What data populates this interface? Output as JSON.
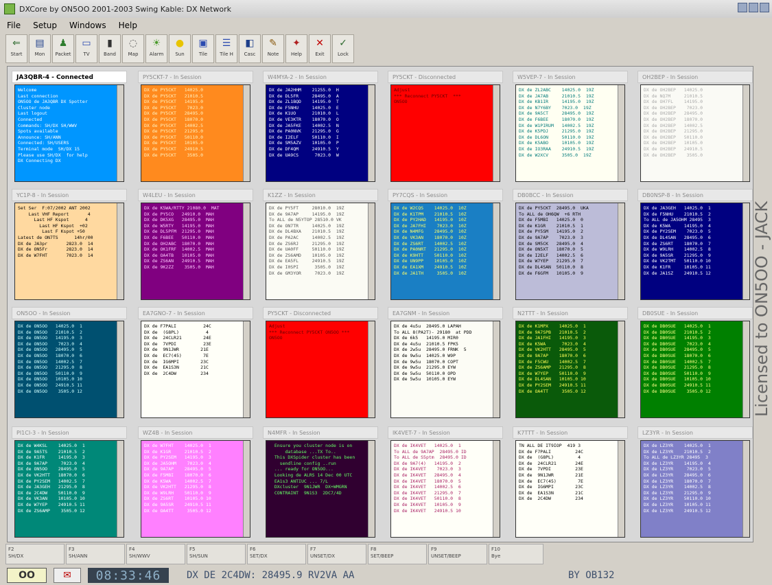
{
  "window": {
    "title": "DXCore by ON5OO 2001-2003 Swing Kable: DX Network"
  },
  "menu": [
    "File",
    "Setup",
    "Windows",
    "Help"
  ],
  "toolbar": [
    {
      "label": "Start",
      "icon": "start-icon",
      "glyph": "⇐",
      "color": "#2e6a2e"
    },
    {
      "label": "Mon",
      "icon": "monitor-icon",
      "glyph": "▤",
      "color": "#1e3f8a"
    },
    {
      "label": "Packet",
      "icon": "packet-icon",
      "glyph": "♟",
      "color": "#2f7d2f"
    },
    {
      "label": "TV",
      "icon": "tv-icon",
      "glyph": "▭",
      "color": "#2b4bb0"
    },
    {
      "label": "Band",
      "icon": "band-icon",
      "glyph": "▮",
      "color": "#333"
    },
    {
      "label": "Map",
      "icon": "map-icon",
      "glyph": "◌",
      "color": "#555"
    },
    {
      "label": "Alarm",
      "icon": "alarm-icon",
      "glyph": "☀",
      "color": "#4a9a2a"
    },
    {
      "label": "Sun",
      "icon": "sun-icon",
      "glyph": "●",
      "color": "#e8c400"
    },
    {
      "label": "Tile",
      "icon": "tile-icon",
      "glyph": "▣",
      "color": "#2b4bb0"
    },
    {
      "label": "Tile H",
      "icon": "tile-horizontal-icon",
      "glyph": "☰",
      "color": "#2b4bb0"
    },
    {
      "label": "Casc",
      "icon": "cascade-icon",
      "glyph": "◧",
      "color": "#1e3f8a"
    },
    {
      "label": "Note",
      "icon": "note-icon",
      "glyph": "✎",
      "color": "#8a5a10"
    },
    {
      "label": "Help",
      "icon": "help-icon",
      "glyph": "✦",
      "color": "#b02020"
    },
    {
      "label": "Exit",
      "icon": "exit-icon",
      "glyph": "✕",
      "color": "#c00000"
    },
    {
      "label": "Lock",
      "icon": "lock-icon",
      "glyph": "✓",
      "color": "#2e6a2e"
    }
  ],
  "panels": [
    {
      "title": "JA3QBR-4 - Connected",
      "active": true,
      "bg": "#0096ff",
      "fg": "#ffffff",
      "lines": [
        "Welcome",
        "Last connection",
        "ON5OO de JA3QBR DX Spotter",
        "Cluster node",
        "Last logout",
        "Connected",
        "Commands: SH/DX SH/WWV",
        "Spots available",
        "Announce: SH/ANN",
        "Connected: SH/USERS",
        "",
        "Terminal mode  SH/DX 15",
        "Please use SH/DX  for help",
        "DX Connecting DX"
      ]
    },
    {
      "title": "PY5CKT-7 - In Session",
      "bg": "#ff8a1e",
      "fg": "#fff2c0",
      "lines": [
        "DX de PY5CKT   14025.0",
        "DX de PY5CKT   21010.5",
        "DX de PY5CKT   14195.0",
        "DX de PY5CKT    7023.0",
        "DX de PY5CKT   28495.0",
        "DX de PY5CKT   18070.0",
        "DX de PY5CKT   14002.5",
        "DX de PY5CKT   21295.0",
        "DX de PY5CKT   50110.0",
        "DX de PY5CKT   10105.0",
        "DX de PY5CKT   24910.5",
        "DX de PY5CKT    3505.0"
      ]
    },
    {
      "title": "W4MYA-2 - In Session",
      "bg": "#000080",
      "fg": "#ffffff",
      "lines": [
        "DX de JA2HHM    21255.0  H",
        "DX de DL5FR     28495.0  A",
        "DX de ZL1BQD    14195.0  T",
        "DX de F5NHU     14025.0  E",
        "DX de K1UO      21010.0  L",
        "DX de VE3KTR    18070.0  O",
        "DX de JA5FKE    14002.5  N",
        "DX de PA0NVK    21295.0  G",
        "DX de I2ELF     50110.0  I",
        "DX de SM5AZV    10105.0  P",
        "DX de DF4QM     24910.5  Y",
        "DX de UA9CS      7023.0  W"
      ]
    },
    {
      "title": "PY5CKT - Disconnected",
      "bg": "#ff0000",
      "fg": "#660000",
      "lines": [
        "Adjust",
        "*** Reconnect PY5CKT  ***",
        "ON5OO"
      ]
    },
    {
      "title": "W5VEP-7 - In Session",
      "bg": "#fffff2",
      "fg": "#007a7a",
      "lines": [
        "DX de ZL2ABC    14025.0  19Z",
        "DX de JA7AB     21010.5  19Z",
        "DX de KB1IR     14195.0  19Z",
        "DX de N7Y6BY    7023.0  19Z",
        "DX de 9A5CT     28495.0  19Z",
        "DX de F6BEE     18070.0  19Z",
        "DX de W1PIRUM   14002.5  19Z",
        "DX de K5PDJ     21295.0  19Z",
        "DX de DL6ON     50110.0  19Z",
        "DX de K5ABO     10105.0  19Z",
        "DX de IO3RAA    24910.5  19Z",
        "DX de W2XCV     3505.0  19Z"
      ]
    },
    {
      "title": "OH2BEP - In Session",
      "bg": "#fafaf5",
      "fg": "#aaaaaa",
      "lines": [
        "DX de OH2BEP   14025.0",
        "DX de NQ7M     21010.5",
        "DX de OH7FL    14195.0",
        "DX de OH2BEP    7023.0",
        "DX de OH2BEP   28495.0",
        "DX de OH2BEP   18070.0",
        "DX de OH2BEP   14002.5",
        "DX de OH2BEP   21295.0",
        "DX de OH2BEP   50110.0",
        "DX de OH2BEP   10105.0",
        "DX de OH2BEP   24910.5",
        "DX de OH2BEP    3505.0"
      ]
    },
    {
      "title": "YC1P-8 - In Session",
      "bg": "#ffd9a0",
      "fg": "#000000",
      "lines": [
        "Set Ser  F:07/2002 ANT 2002",
        "    Last VHF Report       4",
        "      Last HF Kspot      4",
        "        Last HF Kspot  +02",
        "         Last F Kspot +50",
        "",
        "Latest de ON7TS      14hr/00",
        "DX de JA3pr       2823.0  14",
        "DX de ON5Fr       2823.0  14",
        "DX de W7FHT       7023.0  14"
      ]
    },
    {
      "title": "W4LEU - In Session",
      "bg": "#800080",
      "fg": "#ffccff",
      "lines": [
        "DX de K5WA/RTTY 21080.0  MAT",
        "DX de PY5CO   24910.0  MAH",
        "DX de DK5XG   28495.0  MAH",
        "DX de W5RTY   14195.0  MAH",
        "DX de DL5PFM  21295.0  MAH",
        "DX de F6BEE   50110.0  MAH",
        "DX de OH2ABC  18070.0  MAH",
        "DX de OK1FRF  14002.5  MAH",
        "DX de OA4TB   10105.0  MAH",
        "DX de ZS6AN   24910.5  MAH",
        "DX de 9K2ZZ    3505.0  MAH"
      ]
    },
    {
      "title": "K1ZZ - In Session",
      "bg": "#fbfbf4",
      "fg": "#555555",
      "lines": [
        "DX de PY5FT     28010.0  19Z",
        "DX de 9A7AP     14195.0  19Z",
        "To ALL de N5YTOP 28510.0 VK",
        "DX de ON7TR     14025.0  19Z",
        "DX de DL4BXA    21010.5  19Z",
        "DX de PA2AC     14002.5  19Z",
        "DX de ZS6RJ     21295.0  19Z",
        "DX de UA0FF     50110.0  19Z",
        "DX de ZS6AMD    10105.0  19Z",
        "DX de EA5FL     24910.5  19Z",
        "DX de I0SPI      3505.0  19Z",
        "DX de GM3YOR     7023.0  19Z"
      ]
    },
    {
      "title": "PY7CQS - In Session",
      "bg": "#1a7fc4",
      "fg": "#ffff66",
      "lines": [
        "DX de W2CQS    14025.0  10Z",
        "DX de K1TPM    21010.5  10Z",
        "DX de PY2HAD   14195.0  10Z",
        "DX de JA7FHI    7023.0  10Z",
        "DX de N4MFG    28495.0  10Z",
        "DX de VK3AN    18070.0  10Z",
        "DX de ZS6RT    14002.5  10Z",
        "DX de PA0NRT   21295.0  10Z",
        "DX de K9HTT    50110.0  10Z",
        "DX de UN9PP    10105.0  10Z",
        "DX de EA1XM    24910.5  10Z",
        "DX de JA1TH     3505.0  10Z"
      ]
    },
    {
      "title": "DB0BCC - In Session",
      "bg": "#bcbcd8",
      "fg": "#000000",
      "lines": [
        "DX de PY5CKT  28495.0  UKA",
        "To ALL de OH6QW  +6 RTH",
        "DX de F5MBI   14025.0  0",
        "DX de K1GR    21010.5  1",
        "DX de PY5SM   14195.0  2",
        "DX de 9A7AP    7023.0  3",
        "DX de SM5CK   28495.0  4",
        "DX de ON5XT   18070.0  5",
        "DX de I2ELF   14002.5  6",
        "DX de W7YEP   21295.0  7",
        "DX de DL4SAN  50110.0  8",
        "DX de F6GFM   10105.0  9"
      ]
    },
    {
      "title": "DB0NSP-8 - In Session",
      "bg": "#000080",
      "fg": "#ffffff",
      "lines": [
        "DX de JA3GEH   14025.0  1",
        "DX de F5NHU    21010.5  2",
        "To ALL de JA5OHM 28495  3",
        "DX de K5WA     14195.0  4",
        "DX de PY2SEM    7023.0  5",
        "DX de DL4SAN   28495.0  6",
        "DX de ZS6RT    18070.0  7",
        "DX de W9LRH    14002.5  8",
        "DX de 9A5SR    21295.0  9",
        "DX de VK2TMT   50110.0 10",
        "DX de K1FR     10105.0 11",
        "DX de JA1SZ    24910.5 12"
      ]
    },
    {
      "title": "ON5OO - In Session",
      "bg": "#005070",
      "fg": "#d0ffff",
      "lines": [
        "DX de ON5OO   14025.0  1",
        "DX de ON5OO   21010.5  2",
        "DX de ON5OO   14195.0  3",
        "DX de ON5OO    7023.0  4",
        "DX de ON5OO   28495.0  5",
        "DX de ON5OO   18070.0  6",
        "DX de ON5OO   14002.5  7",
        "DX de ON5OO   21295.0  8",
        "DX de ON5OO   50110.0  9",
        "DX de ON5OO   10105.0 10",
        "DX de ON5OO   24910.5 11",
        "DX de ON5OO    3505.0 12"
      ]
    },
    {
      "title": "EA7GNO-7 - In Session",
      "bg": "#fffff8",
      "fg": "#000000",
      "lines": [
        "DX de F7PALI          24C",
        "DX de  (G8PL)          4",
        "DX de  24CLR21        24E",
        "DX de  7VPDI          23E",
        "DX de  9N1JWR        21E",
        "DX de  EC7(45)        7E",
        "DX de  IG6MPI        23C",
        "DX de  EA1S3N        21C",
        "DX de  2C4DW         234"
      ]
    },
    {
      "title": "PY5CKT - Disconnected",
      "bg": "#ff0000",
      "fg": "#660000",
      "lines": [
        "Adjust",
        "*** Reconnect PY5CKT ON5OO ***",
        "ON5OO"
      ]
    },
    {
      "title": "EA7GNM - In Session",
      "bg": "#fcfcf5",
      "fg": "#000000",
      "lines": [
        "DX de 4u5u  28495.0 LAPAH",
        "To ALL 8(PA2T)- 29180  at PDD",
        "DX de 6k5   14195.0 MIR0",
        "DX de 4u5u  21010.5 FPK5",
        "DX de 2w5u  28495.0 FRNK  5",
        "DX de 9w5u  14025.0 W9P",
        "DX de 9w5u  18070.0 COPT",
        "DX de 9w5u  21295.0 EYW",
        "DX de 5w5u  50110.0 OPD",
        "DX de 5w5u  10105.0 EYW"
      ]
    },
    {
      "title": "N2TTT - In Session",
      "bg": "#0a5a0a",
      "fg": "#ffff55",
      "lines": [
        "DX de K1MPX    14025.0  1",
        "DX de 9A7SPB   21010.5  2",
        "DX de JA1FHI   14195.0  3",
        "DX de K5WA      7023.0  4",
        "DX de VK2HTT   28495.0  5",
        "DX de 9A7AP    18070.0  6",
        "DX de F5CWU    14002.5  7",
        "DX de ZS6AMP   21295.0  8",
        "DX de W7YEP    50110.0  9",
        "DX de DL4SAN   10105.0 10",
        "DX de PY2SEM   24910.5 11",
        "DX de OA4TT     3505.0 12"
      ]
    },
    {
      "title": "DB0SUE - In Session",
      "bg": "#008000",
      "fg": "#ffff88",
      "lines": [
        "DX de DB0SUE   14025.0  1",
        "DX de DB0SUE   21010.5  2",
        "DX de DB0SUE   14195.0  3",
        "DX de DB0SUE    7023.0  4",
        "DX de DB0SUE   28495.0  5",
        "DX de DB0SUE   18070.0  6",
        "DX de DB0SUE   14002.5  7",
        "DX de DB0SUE   21295.0  8",
        "DX de DB0SUE   50110.0  9",
        "DX de DB0SUE   10105.0 10",
        "DX de DB0SUE   24910.5 11",
        "DX de DB0SUE    3505.0 12"
      ]
    },
    {
      "title": "PI1CI-3 - In Session",
      "bg": "#008878",
      "fg": "#ffffff",
      "lines": [
        "DX de W4KSL    14025.0  1",
        "DX de 9A5TS    21010.5  2",
        "DX de K1FR     14195.0  3",
        "DX de 9A7AP     7023.0  4",
        "DX de ON5OO    28495.0  5",
        "DX de VK2HTT   18070.0  6",
        "DX de PY2SEM   14002.5  7",
        "DX de JA3GEH   21295.0  8",
        "DX de 2C4DW    50110.0  9",
        "DX de VK3AN    10105.0 10",
        "DX de W7YEP    24910.5 11",
        "DX de ZS6AMP    3505.0 12"
      ]
    },
    {
      "title": "WZ4B - In Session",
      "bg": "#ff80ff",
      "fg": "#ffffff",
      "lines": [
        "DX de W7FHT    14025.0  1",
        "DX de K1GR     21010.5  2",
        "DX de PY2SEM   14195.0  3",
        "DX de JA5OHM    7023.0  4",
        "DX de 9A7AP    28495.0  5",
        "DX de F5MBI    18070.0  6",
        "DX de K5WA     14002.5  7",
        "DX de VK2HTT   21295.0  8",
        "DX de W9LRH    50110.0  9",
        "DX de ZS6RT    10105.0 10",
        "DX de 9A5SR    24910.5 11",
        "DX de OA4TT     3505.0 12"
      ]
    },
    {
      "title": "N4MFR - In Session",
      "bg": "#300030",
      "fg": "#66ff66",
      "lines": [
        "  Ensure you cluster node is on",
        "      database ...TX To..",
        "",
        "  This DXSpider cluster has been",
        "    sendline config ..run",
        "",
        "  ... ready for ON5OO...",
        "  Looking de ALRS 14 Dec 00 UTC",
        "  EA1s3 ANTIUC ... 7/L",
        "  DXcluster  9N1JWR  DX+WMGRN",
        "  CONTRAINT  9N1S3  2DC7/4D"
      ]
    },
    {
      "title": "IK4VET-7 - In Session",
      "bg": "#fffff8",
      "fg": "#aa2266",
      "lines": [
        "DX de IK4VET   14025.0  1",
        "To ALL de 9A7AP  28495.0 ID",
        "To ALL de S5ptm  28495.0 ID",
        "DX de 9A7(4)   14195.0  2",
        "DX de IK4VET    7023.0  3",
        "DX de IK4VET   28495.0  4",
        "DX de IK4VET   18070.0  5",
        "DX de IK4VET   14002.5  6",
        "DX de IK4VET   21295.0  7",
        "DX de IK4VET   50110.0  8",
        "DX de IK4VET   10105.0  9",
        "DX de IK4VET   24910.5 10"
      ]
    },
    {
      "title": "K7TTT - In Session",
      "bg": "#fffff8",
      "fg": "#000000",
      "lines": [
        "TN ALL DE IT9IOP  419 3",
        "DX de F7PALI         24C",
        "DX de  (G8PL)         4",
        "DX de  24CLR21       24E",
        "DX de  7VPDI         23E",
        "DX de  9N1JWR        21E",
        "DX de  EC7(45)        7E",
        "DX de  IG6MPI        23C",
        "DX de  EA1S3N        21C",
        "DX de  2C4DW         234"
      ]
    },
    {
      "title": "LZ3YR - In Session",
      "bg": "#8080c8",
      "fg": "#ffffff",
      "lines": [
        "DX de LZ3YR    14025.0  1",
        "DX de LZ3YR    21010.5  2",
        "To ALL de LZ3YR 28495  3",
        "DX de LZ3YR    14195.0  4",
        "DX de LZ3YR     7023.0  5",
        "DX de LZ3YR    28495.0  6",
        "DX de LZ3YR    18070.0  7",
        "DX de LZ3YR    14002.5  8",
        "DX de LZ3YR    21295.0  9",
        "DX de LZ3YR    50110.0 10",
        "DX de LZ3YR    10105.0 11",
        "DX de LZ3YR    24910.5 12"
      ]
    }
  ],
  "licensed": "Licensed to ON5OO - JACK",
  "fkeys": [
    {
      "key": "F2",
      "label": "SH/DX"
    },
    {
      "key": "F3",
      "label": "SH/ANN"
    },
    {
      "key": "F4",
      "label": "SH/WWV"
    },
    {
      "key": "F5",
      "label": "SH/SUN"
    },
    {
      "key": "F6",
      "label": "SET/DX"
    },
    {
      "key": "F7",
      "label": "UNSET/DX"
    },
    {
      "key": "F8",
      "label": "SET/BEEP"
    },
    {
      "key": "F9",
      "label": "UNSET/BEEP"
    },
    {
      "key": "F10",
      "label": "Bye"
    }
  ],
  "status": {
    "conn": "OO",
    "clock": "08:33:46",
    "spot": "DX DE 2C4DW:   28495.9  RV2VA  AA",
    "user": "BY OB132"
  }
}
